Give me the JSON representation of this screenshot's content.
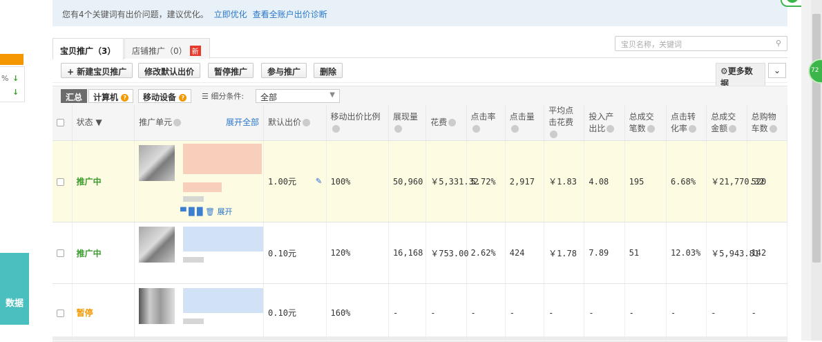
{
  "notice": {
    "text": "您有4个关键词有出价问题，建议优化。",
    "link1": "立即优化",
    "link2": "查看全账户出价诊断"
  },
  "sidebar": {
    "rows": [
      "%",
      ""
    ],
    "bottom_label": "数据"
  },
  "float_badge": "72",
  "tabs": [
    {
      "label": "宝贝推广（3）",
      "active": true
    },
    {
      "label": "店铺推广（0）",
      "badge": "新",
      "active": false
    }
  ],
  "search": {
    "placeholder": "宝贝名称，关键词"
  },
  "toolbar": {
    "new_label": "新建宝贝推广",
    "edit_bid_label": "修改默认出价",
    "pause_label": "暂停推广",
    "join_label": "参与推广",
    "delete_label": "删除",
    "more_label": "更多数据"
  },
  "filter": {
    "summary": "汇总",
    "pc": "计算机",
    "mobile": "移动设备",
    "condition_label": "细分条件:",
    "condition_value": "全部"
  },
  "table": {
    "headers": {
      "status": "状态",
      "unit": "推广单元",
      "expand_all": "展开全部",
      "default_bid": "默认出价",
      "mobile_ratio": "移动出价比例",
      "impressions": "展现量",
      "cost": "花费",
      "ctr": "点击率",
      "clicks": "点击量",
      "avg_cpc": "平均点击花费",
      "roi": "投入产出比",
      "orders": "总成交笔数",
      "conv_rate": "点击转化率",
      "gmv": "总成交金额",
      "cart": "总购物车数"
    },
    "rows": [
      {
        "status": "推广中",
        "status_type": "on",
        "bid": "1.00元",
        "ratio": "100%",
        "impressions": "50,960",
        "cost": "￥5,331.32",
        "ctr": "5.72%",
        "clicks": "2,917",
        "cpc": "￥1.83",
        "roi": "4.08",
        "orders": "195",
        "conv": "6.68%",
        "gmv": "￥21,770.32",
        "cart": "520",
        "expand": "展开"
      },
      {
        "status": "推广中",
        "status_type": "on",
        "bid": "0.10元",
        "ratio": "120%",
        "impressions": "16,168",
        "cost": "￥753.00",
        "ctr": "2.62%",
        "clicks": "424",
        "cpc": "￥1.78",
        "roi": "7.89",
        "orders": "51",
        "conv": "12.03%",
        "gmv": "￥5,943.81",
        "cart": "142"
      },
      {
        "status": "暂停",
        "status_type": "off",
        "bid": "0.10元",
        "ratio": "160%",
        "impressions": "-",
        "cost": "-",
        "ctr": "-",
        "clicks": "-",
        "cpc": "-",
        "roi": "-",
        "orders": "-",
        "conv": "-",
        "gmv": "-",
        "cart": "-"
      }
    ]
  }
}
